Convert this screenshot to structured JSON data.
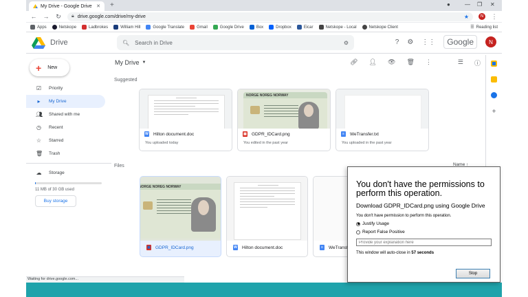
{
  "browser": {
    "tab_title": "My Drive - Google Drive",
    "url": "drive.google.com/drive/my-drive",
    "profile_initial": "N",
    "bookmarks": [
      {
        "label": "Apps",
        "color": "#5f6368"
      },
      {
        "label": "Netskope",
        "color": "#1a1a2e"
      },
      {
        "label": "Ladbrokes",
        "color": "#d32f2f"
      },
      {
        "label": "William Hill",
        "color": "#1a3c7a"
      },
      {
        "label": "Google Translate",
        "color": "#4285f4"
      },
      {
        "label": "Gmail",
        "color": "#ea4335"
      },
      {
        "label": "Google Drive",
        "color": "#34a853"
      },
      {
        "label": "Box",
        "color": "#0061d5"
      },
      {
        "label": "Dropbox",
        "color": "#0061fe"
      },
      {
        "label": "Eicar",
        "color": "#2b579a"
      },
      {
        "label": "Netskope - Local",
        "color": "#444"
      },
      {
        "label": "Netskope Client",
        "color": "#444"
      }
    ],
    "reading_list": "Reading list",
    "status_text": "Waiting for drive.google.com..."
  },
  "drive": {
    "app_name": "Drive",
    "search_placeholder": "Search in Drive",
    "google_word": "Google",
    "avatar_initial": "N",
    "new_label": "New",
    "nav": [
      {
        "label": "Priority",
        "icon": "check-circle-icon"
      },
      {
        "label": "My Drive",
        "icon": "drive-icon"
      },
      {
        "label": "Shared with me",
        "icon": "people-icon"
      },
      {
        "label": "Recent",
        "icon": "clock-icon"
      },
      {
        "label": "Starred",
        "icon": "star-icon"
      },
      {
        "label": "Trash",
        "icon": "trash-icon"
      }
    ],
    "storage_label": "Storage",
    "storage_used": "11 MB of 30 GB used",
    "storage_fraction": 0.0004,
    "buy_storage": "Buy storage",
    "location": "My Drive",
    "suggested_title": "Suggested",
    "files_title": "Files",
    "sort_label": "Name",
    "suggested": [
      {
        "name": "Hilton document.doc",
        "sub": "You uploaded today",
        "type": "doc"
      },
      {
        "name": "GDPR_IDCard.png",
        "sub": "You edited in the past year",
        "type": "png"
      },
      {
        "name": "WeTransfer.txt",
        "sub": "You uploaded in the past year",
        "type": "txt"
      }
    ],
    "files": [
      {
        "name": "GDPR_IDCard.png",
        "type": "png"
      },
      {
        "name": "Hilton document.doc",
        "type": "doc"
      },
      {
        "name": "WeTransfer.txt",
        "type": "txt"
      }
    ],
    "idcard_header": "NORGE NOREG NORWAY"
  },
  "dialog": {
    "title": "You don't have the permissions to perform this operation.",
    "subtitle": "Download GDPR_IDCard.png using Google Drive",
    "message": "You don't have permission to perform this operation.",
    "options": [
      "Justify Usage",
      "Report False Positive"
    ],
    "selected_option": "Justify Usage",
    "explanation_placeholder": "Provide your explanation here",
    "autoclose_prefix": "This window will auto-close in",
    "autoclose_time": "57 seconds",
    "stop_label": "Stop"
  }
}
